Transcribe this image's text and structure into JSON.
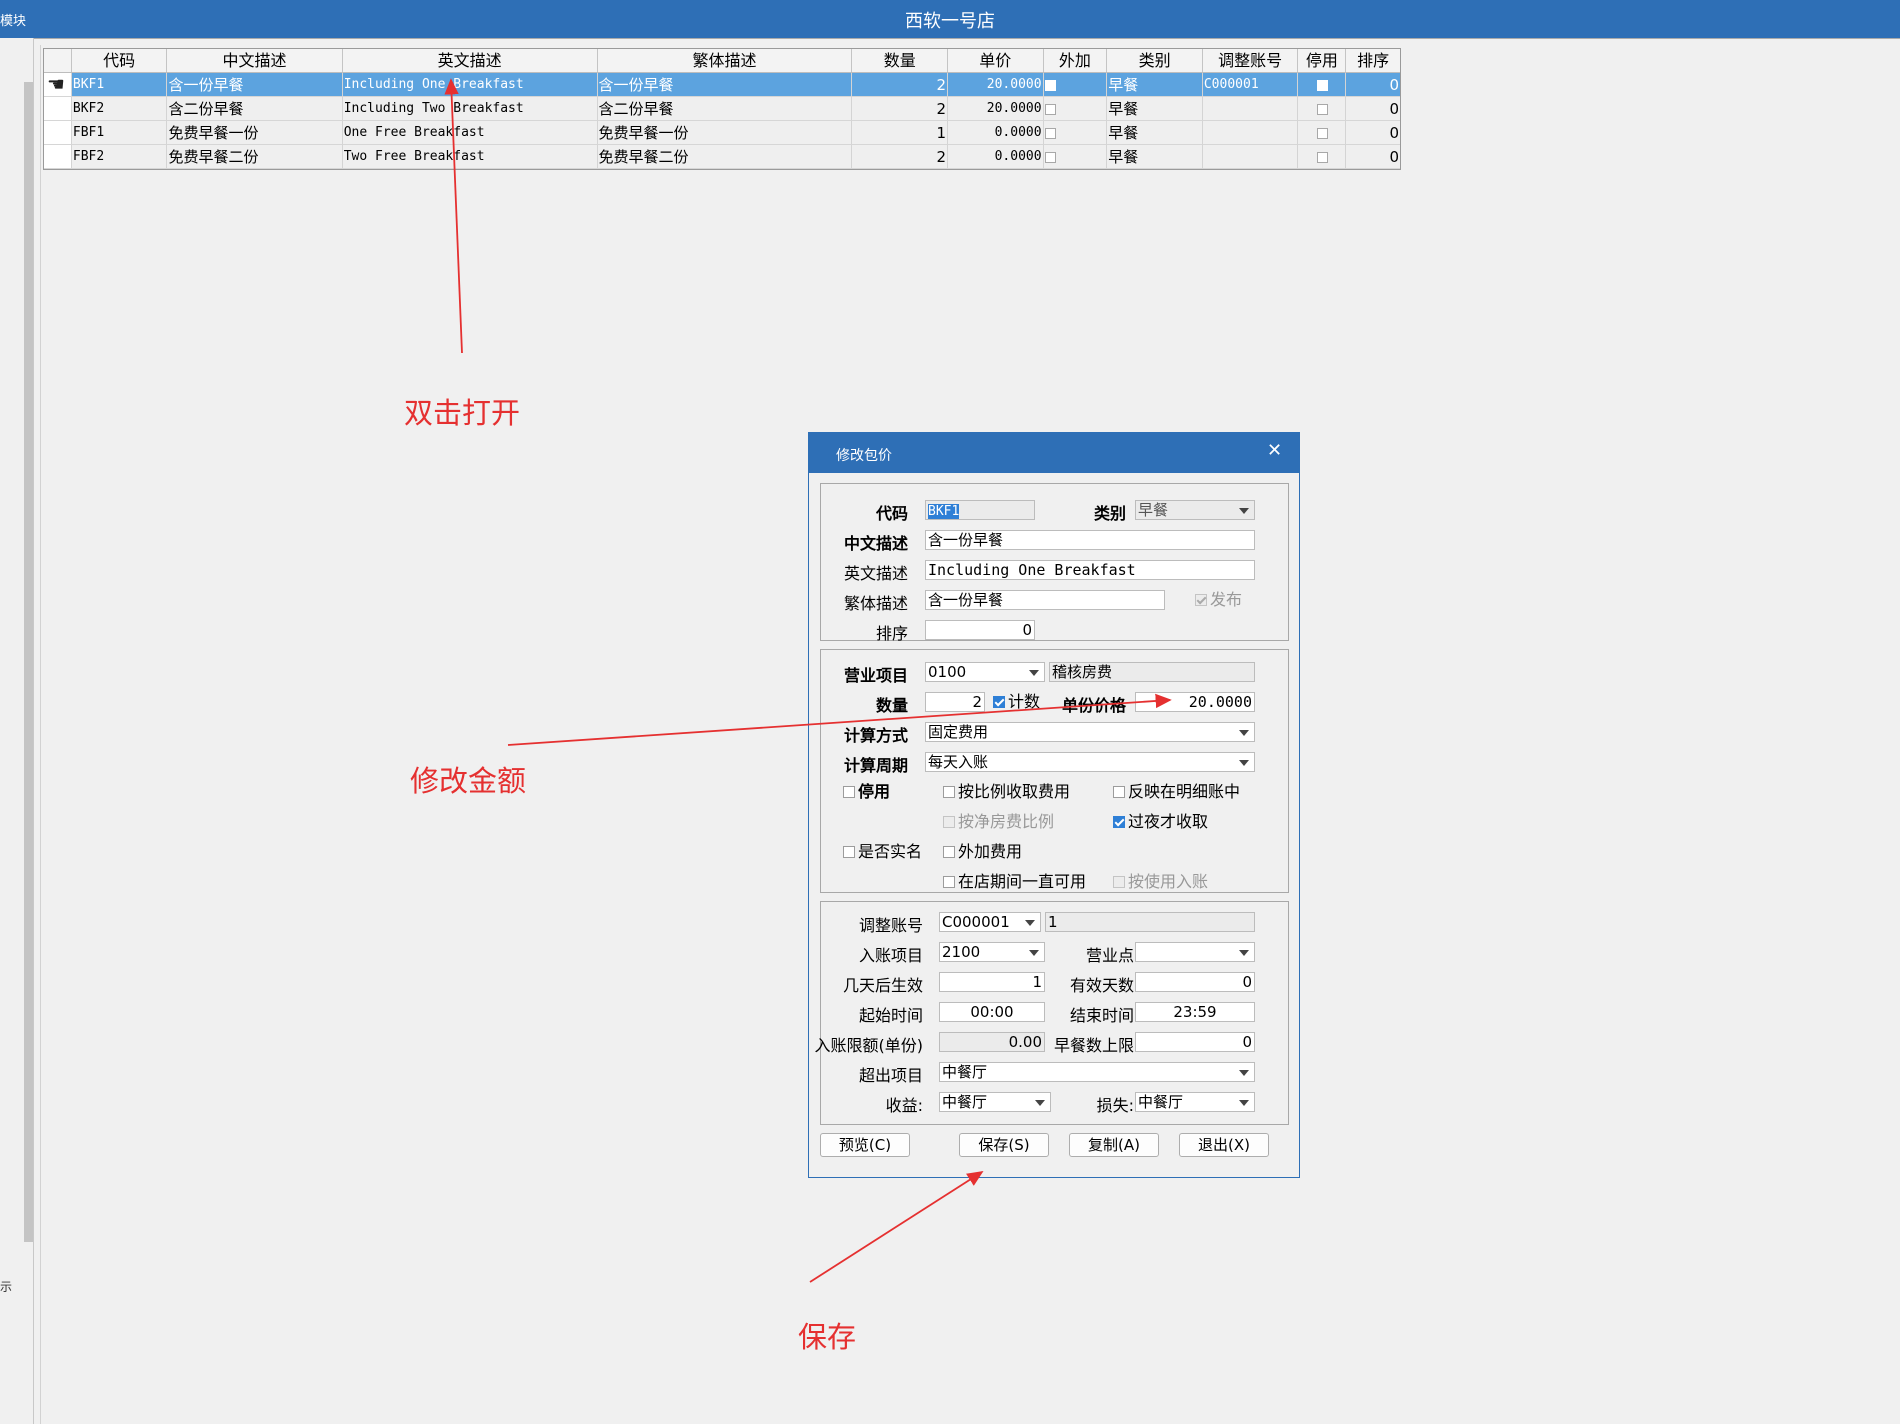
{
  "app": {
    "module_label": "模块",
    "title": "西软一号店",
    "left_char": "示"
  },
  "grid": {
    "headers": [
      "代码",
      "中文描述",
      "英文描述",
      "繁体描述",
      "数量",
      "单价",
      "外加",
      "类别",
      "调整账号",
      "停用",
      "排序"
    ],
    "rows": [
      {
        "code": "BKF1",
        "cn": "含一份早餐",
        "en": "Including One Breakfast",
        "tw": "含一份早餐",
        "qty": "2",
        "price": "20.0000",
        "extra": false,
        "category": "早餐",
        "account": "C000001",
        "disabled": false,
        "sort": "0",
        "selected": true
      },
      {
        "code": "BKF2",
        "cn": "含二份早餐",
        "en": "Including Two Breakfast",
        "tw": "含二份早餐",
        "qty": "2",
        "price": "20.0000",
        "extra": false,
        "category": "早餐",
        "account": "",
        "disabled": false,
        "sort": "0",
        "selected": false
      },
      {
        "code": "FBF1",
        "cn": "免费早餐一份",
        "en": "One Free Breakfast",
        "tw": "免费早餐一份",
        "qty": "1",
        "price": "0.0000",
        "extra": false,
        "category": "早餐",
        "account": "",
        "disabled": false,
        "sort": "0",
        "selected": false
      },
      {
        "code": "FBF2",
        "cn": "免费早餐二份",
        "en": "Two Free Breakfast",
        "tw": "免费早餐二份",
        "qty": "2",
        "price": "0.0000",
        "extra": false,
        "category": "早餐",
        "account": "",
        "disabled": false,
        "sort": "0",
        "selected": false
      }
    ]
  },
  "dialog": {
    "title": "修改包价",
    "close_glyph": "✕",
    "labels": {
      "code": "代码",
      "category": "类别",
      "cn_desc": "中文描述",
      "en_desc": "英文描述",
      "tw_desc": "繁体描述",
      "sort": "排序",
      "business_item": "营业项目",
      "quantity": "数量",
      "unit_price": "单份价格",
      "calc_method": "计算方式",
      "calc_cycle": "计算周期",
      "adjust_account": "调整账号",
      "posting_item": "入账项目",
      "business_point": "营业点",
      "days_effective": "几天后生效",
      "valid_days": "有效天数",
      "start_time": "起始时间",
      "end_time": "结束时间",
      "posting_limit": "入账限额(单份)",
      "breakfast_limit": "早餐数上限",
      "overflow_item": "超出项目",
      "revenue": "收益:",
      "loss": "损失:"
    },
    "values": {
      "code": "BKF1",
      "category": "早餐",
      "cn_desc": "含一份早餐",
      "en_desc": "Including One Breakfast",
      "tw_desc": "含一份早餐",
      "sort": "0",
      "business_item": "0100",
      "business_item_name": "稽核房费",
      "quantity": "2",
      "unit_price": "20.0000",
      "calc_method": "固定费用",
      "calc_cycle": "每天入账",
      "adjust_account": "C000001",
      "adjust_account_extra": "1",
      "posting_item": "2100",
      "business_point": "",
      "days_effective": "1",
      "valid_days": "0",
      "start_time": "00:00",
      "end_time": "23:59",
      "posting_limit": "0.00",
      "breakfast_limit": "0",
      "overflow_item": "中餐厅",
      "revenue": "中餐厅",
      "loss": "中餐厅"
    },
    "checkboxes": {
      "publish": {
        "label": "发布",
        "checked": true,
        "enabled": false
      },
      "count": {
        "label": "计数",
        "checked": true,
        "enabled": true
      },
      "disabled": {
        "label": "停用",
        "checked": false,
        "enabled": true
      },
      "by_ratio": {
        "label": "按比例收取费用",
        "checked": false,
        "enabled": true
      },
      "show_detail": {
        "label": "反映在明细账中",
        "checked": false,
        "enabled": true
      },
      "net_room_ratio": {
        "label": "按净房费比例",
        "checked": false,
        "enabled": false
      },
      "overnight": {
        "label": "过夜才收取",
        "checked": true,
        "enabled": true
      },
      "real_name": {
        "label": "是否实名",
        "checked": false,
        "enabled": true
      },
      "extra_fee": {
        "label": "外加费用",
        "checked": false,
        "enabled": true
      },
      "always_available": {
        "label": "在店期间一直可用",
        "checked": false,
        "enabled": true
      },
      "by_usage": {
        "label": "按使用入账",
        "checked": false,
        "enabled": false
      }
    },
    "buttons": {
      "preview": "预览(C)",
      "save": "保存(S)",
      "copy": "复制(A)",
      "exit": "退出(X)"
    }
  },
  "annotations": {
    "double_click": "双击打开",
    "edit_amount": "修改金额",
    "save": "保存",
    "color": "#e53030"
  }
}
